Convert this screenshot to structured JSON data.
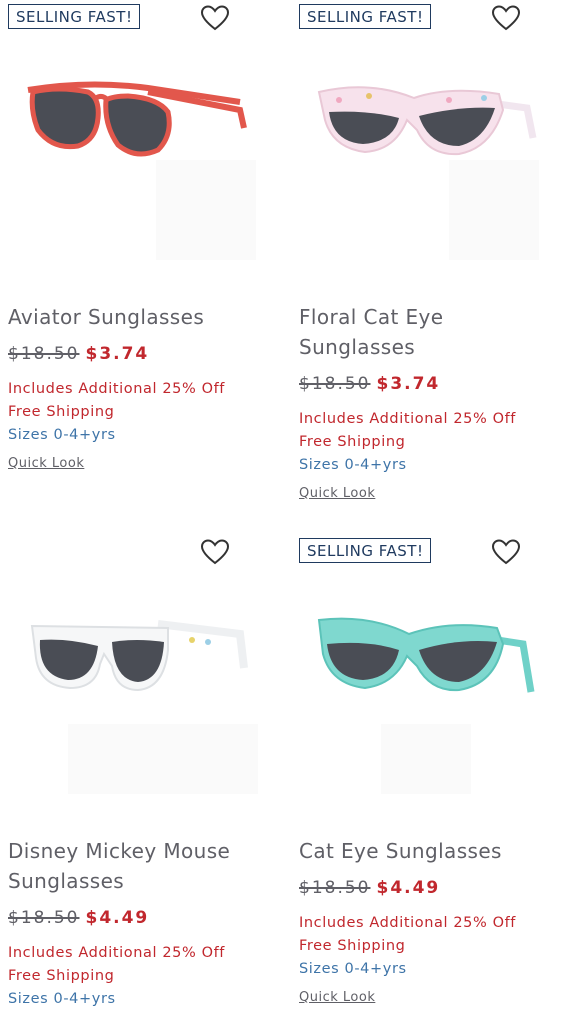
{
  "colors": {
    "sale_red": "#c1272d",
    "size_blue": "#3e74a8",
    "badge_navy": "#1f3a5f",
    "text_gray": "#5f5f66"
  },
  "products": [
    {
      "badge": "SELLING FAST!",
      "name": "Aviator Sunglasses",
      "was_price": "$18.50",
      "now_price": "$3.74",
      "promo": "Includes Additional 25% Off",
      "shipping": "Free Shipping",
      "sizes": "Sizes 0-4+yrs",
      "quick_look": "Quick Look",
      "icon": "heart-outline-icon"
    },
    {
      "badge": "SELLING FAST!",
      "name": "Floral Cat Eye Sunglasses",
      "was_price": "$18.50",
      "now_price": "$3.74",
      "promo": "Includes Additional 25% Off",
      "shipping": "Free Shipping",
      "sizes": "Sizes 0-4+yrs",
      "quick_look": "Quick Look",
      "icon": "heart-outline-icon"
    },
    {
      "badge": "",
      "name": "Disney Mickey Mouse Sunglasses",
      "was_price": "$18.50",
      "now_price": "$4.49",
      "promo": "Includes Additional 25% Off",
      "shipping": "Free Shipping",
      "sizes": "Sizes 0-4+yrs",
      "quick_look": "",
      "icon": "heart-outline-icon"
    },
    {
      "badge": "SELLING FAST!",
      "name": "Cat Eye Sunglasses",
      "was_price": "$18.50",
      "now_price": "$4.49",
      "promo": "Includes Additional 25% Off",
      "shipping": "Free Shipping",
      "sizes": "Sizes 0-4+yrs",
      "quick_look": "Quick Look",
      "icon": "heart-outline-icon"
    }
  ]
}
